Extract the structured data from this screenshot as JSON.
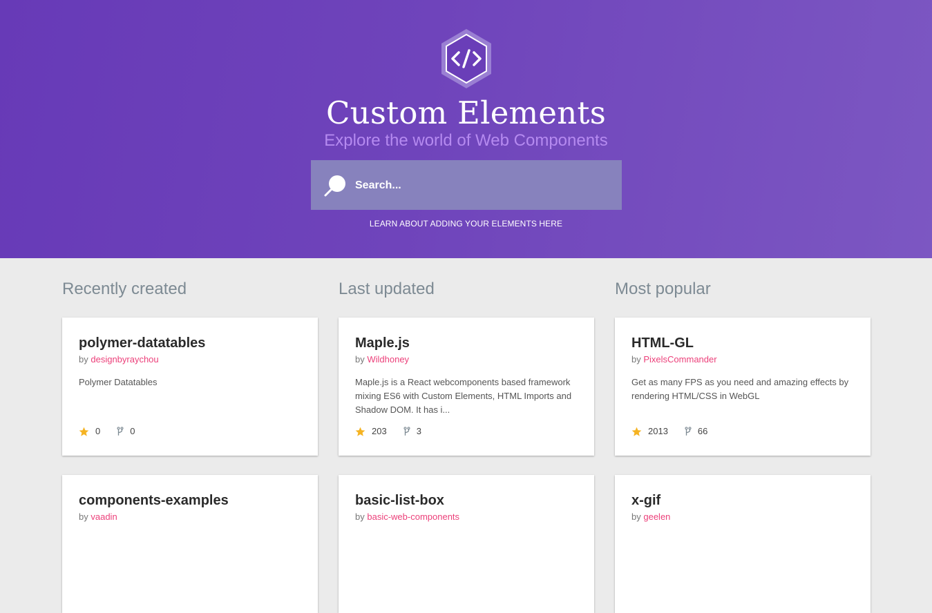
{
  "hero": {
    "title": "Custom Elements",
    "subtitle": "Explore the world of Web Components",
    "search_placeholder": "Search...",
    "learn_link": "LEARN ABOUT ADDING YOUR ELEMENTS HERE",
    "logo_icon": "code-hexagon-icon",
    "search_icon": "search-icon"
  },
  "colors": {
    "hero_gradient_start": "#673ab7",
    "hero_gradient_end": "#7c57c2",
    "subtitle": "#b58af0",
    "search_box": "#8782bd",
    "author_link": "#ec407a",
    "star": "#f5b322",
    "background": "#ebebeb"
  },
  "columns": [
    {
      "heading": "Recently created",
      "cards": [
        {
          "title": "polymer-datatables",
          "by": "by",
          "author": "designbyraychou",
          "description": "Polymer Datatables",
          "stars": "0",
          "forks": "0"
        },
        {
          "title": "components-examples",
          "by": "by",
          "author": "vaadin",
          "description": "",
          "stars": "",
          "forks": ""
        }
      ]
    },
    {
      "heading": "Last updated",
      "cards": [
        {
          "title": "Maple.js",
          "by": "by",
          "author": "Wildhoney",
          "description": "Maple.js is a React webcomponents based framework mixing ES6 with Custom Elements, HTML Imports and Shadow DOM. It has i...",
          "stars": "203",
          "forks": "3"
        },
        {
          "title": "basic-list-box",
          "by": "by",
          "author": "basic-web-components",
          "description": "",
          "stars": "",
          "forks": ""
        }
      ]
    },
    {
      "heading": "Most popular",
      "cards": [
        {
          "title": "HTML-GL",
          "by": "by",
          "author": "PixelsCommander",
          "description": "Get as many FPS as you need and amazing effects by rendering HTML/CSS in WebGL",
          "stars": "2013",
          "forks": "66"
        },
        {
          "title": "x-gif",
          "by": "by",
          "author": "geelen",
          "description": "",
          "stars": "",
          "forks": ""
        }
      ]
    }
  ],
  "icons": {
    "star": "star-icon",
    "fork": "fork-icon"
  }
}
